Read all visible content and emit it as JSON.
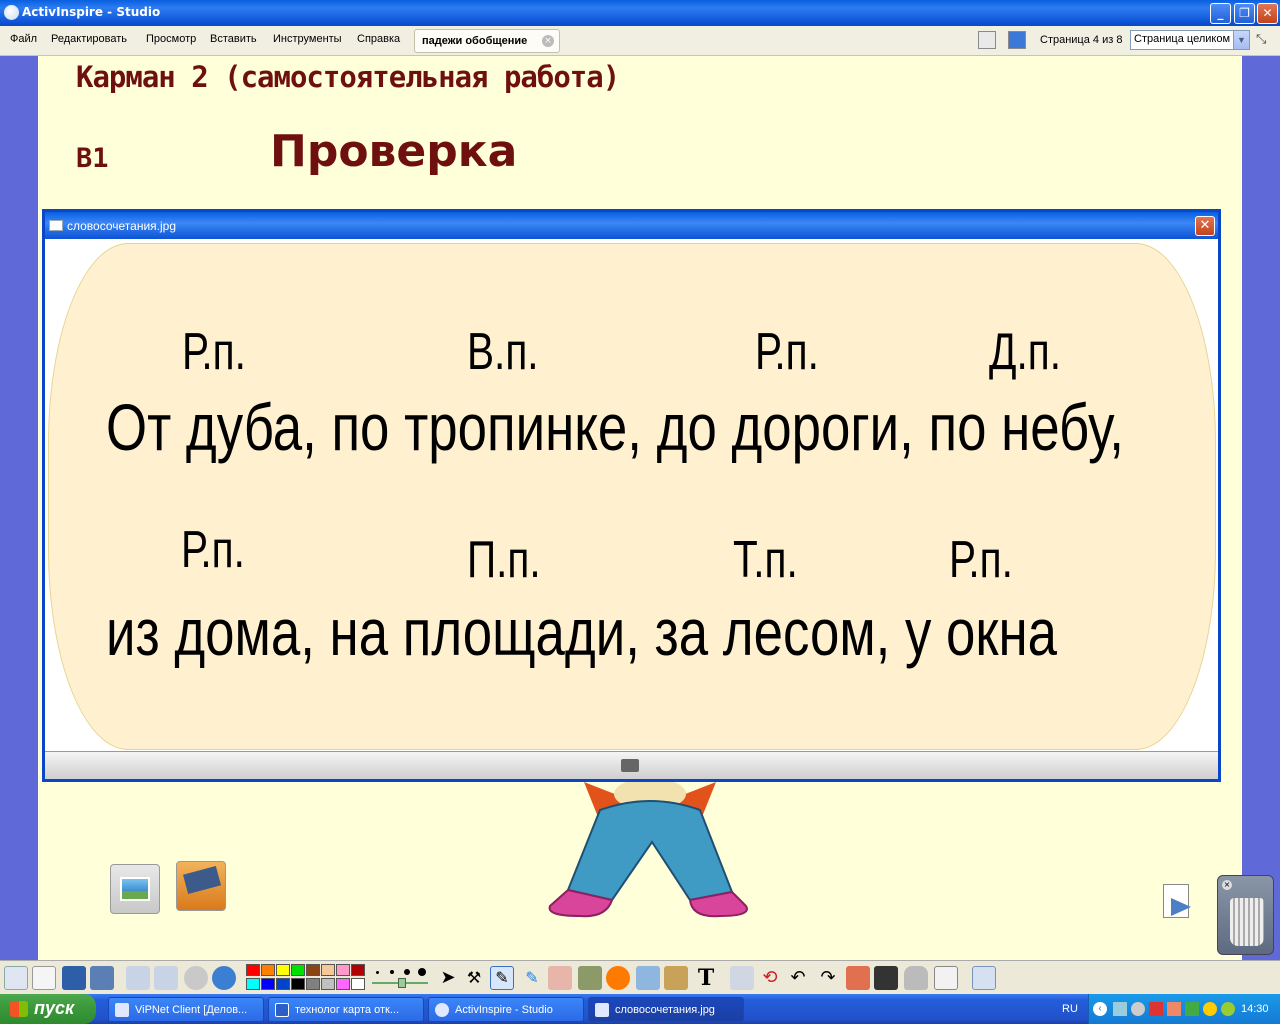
{
  "app": {
    "title": "ActivInspire - Studio"
  },
  "menu": [
    "Файл",
    "Редактировать",
    "Просмотр",
    "Вставить",
    "Инструменты",
    "Справка"
  ],
  "document_tab": {
    "label": "падежи обобщение"
  },
  "page_indicator": "Страница 4 из 8",
  "zoom": {
    "value": "Страница целиком"
  },
  "page": {
    "heading": "Карман 2 (самостоятельная работа)",
    "variant": "В1",
    "check_title": "Проверка"
  },
  "image_window": {
    "title": "словосочетания.jpg",
    "row1": {
      "cases": [
        "Р.п.",
        "В.п.",
        "Р.п.",
        "Д.п."
      ],
      "text": "От дуба, по тропинке, до дороги, по небу,"
    },
    "row2": {
      "cases": [
        "Р.п.",
        "П.п.",
        "Т.п.",
        "Р.п."
      ],
      "text": "из дома, на площади, за лесом, у окна"
    }
  },
  "palette": [
    "#ff0000",
    "#ff8000",
    "#ffff00",
    "#00e000",
    "#8b4513",
    "#f5c89a",
    "#ff99cc",
    "#b00000",
    "#00ffff",
    "#0000ff",
    "#0044cc",
    "#000000",
    "#808080",
    "#c0c0c0",
    "#ff66ff",
    "#ffffff"
  ],
  "taskbar": {
    "start": "пуск",
    "tasks": [
      "ViPNet Client [Делов...",
      "технолог карта отк...",
      "ActivInspire - Studio",
      "словосочетания.jpg"
    ],
    "lang": "RU",
    "clock": "14:30"
  }
}
